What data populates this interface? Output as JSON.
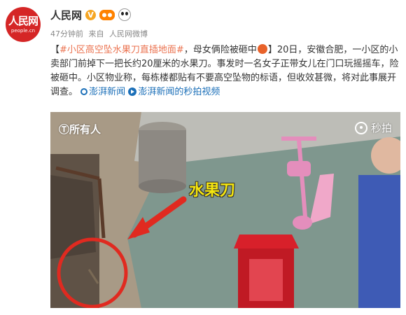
{
  "account": {
    "avatar_logo": "人民网",
    "avatar_domain": "people.cn",
    "name": "人民网",
    "v_badge": "V",
    "icons": [
      "verified-icon",
      "fans-badge-icon",
      "panda-icon"
    ],
    "colors": {
      "avatar": "#d52626",
      "verified": "#f6a623",
      "link": "#eb7350",
      "blue_link": "#1b6fb8"
    }
  },
  "meta": {
    "time": "47分钟前",
    "from_label": "来自",
    "source": "人民网微博"
  },
  "post": {
    "bracket_open": "【",
    "hashtag": "#小区高空坠水果刀直插地面#",
    "headline_rest": "，母女俩险被砸中",
    "bracket_close": "】",
    "body": "20日，安徽合肥，一小区的小卖部门前掉下一把长约20厘米的水果刀。事发时一名女子正带女儿在门口玩摇摇车，险被砸中。小区物业称，每栋楼都贴有不要高空坠物的标语，但收效甚微，将对此事展开调查。",
    "link1": "澎湃新闻",
    "link2": "澎湃新闻的秒拍视频"
  },
  "media": {
    "watermark_left": "Ⓣ所有人",
    "watermark_right": "秒拍",
    "annotation_label": "水果刀"
  }
}
